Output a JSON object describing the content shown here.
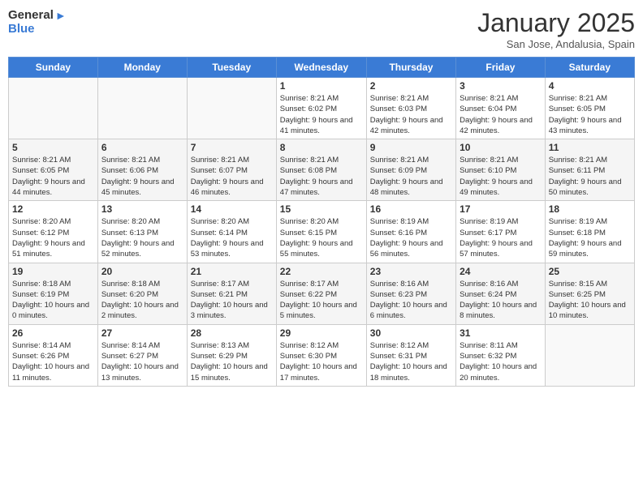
{
  "logo": {
    "general": "General",
    "blue": "Blue"
  },
  "header": {
    "month": "January 2025",
    "location": "San Jose, Andalusia, Spain"
  },
  "weekdays": [
    "Sunday",
    "Monday",
    "Tuesday",
    "Wednesday",
    "Thursday",
    "Friday",
    "Saturday"
  ],
  "weeks": [
    [
      {
        "day": "",
        "sunrise": "",
        "sunset": "",
        "daylight": ""
      },
      {
        "day": "",
        "sunrise": "",
        "sunset": "",
        "daylight": ""
      },
      {
        "day": "",
        "sunrise": "",
        "sunset": "",
        "daylight": ""
      },
      {
        "day": "1",
        "sunrise": "Sunrise: 8:21 AM",
        "sunset": "Sunset: 6:02 PM",
        "daylight": "Daylight: 9 hours and 41 minutes."
      },
      {
        "day": "2",
        "sunrise": "Sunrise: 8:21 AM",
        "sunset": "Sunset: 6:03 PM",
        "daylight": "Daylight: 9 hours and 42 minutes."
      },
      {
        "day": "3",
        "sunrise": "Sunrise: 8:21 AM",
        "sunset": "Sunset: 6:04 PM",
        "daylight": "Daylight: 9 hours and 42 minutes."
      },
      {
        "day": "4",
        "sunrise": "Sunrise: 8:21 AM",
        "sunset": "Sunset: 6:05 PM",
        "daylight": "Daylight: 9 hours and 43 minutes."
      }
    ],
    [
      {
        "day": "5",
        "sunrise": "Sunrise: 8:21 AM",
        "sunset": "Sunset: 6:05 PM",
        "daylight": "Daylight: 9 hours and 44 minutes."
      },
      {
        "day": "6",
        "sunrise": "Sunrise: 8:21 AM",
        "sunset": "Sunset: 6:06 PM",
        "daylight": "Daylight: 9 hours and 45 minutes."
      },
      {
        "day": "7",
        "sunrise": "Sunrise: 8:21 AM",
        "sunset": "Sunset: 6:07 PM",
        "daylight": "Daylight: 9 hours and 46 minutes."
      },
      {
        "day": "8",
        "sunrise": "Sunrise: 8:21 AM",
        "sunset": "Sunset: 6:08 PM",
        "daylight": "Daylight: 9 hours and 47 minutes."
      },
      {
        "day": "9",
        "sunrise": "Sunrise: 8:21 AM",
        "sunset": "Sunset: 6:09 PM",
        "daylight": "Daylight: 9 hours and 48 minutes."
      },
      {
        "day": "10",
        "sunrise": "Sunrise: 8:21 AM",
        "sunset": "Sunset: 6:10 PM",
        "daylight": "Daylight: 9 hours and 49 minutes."
      },
      {
        "day": "11",
        "sunrise": "Sunrise: 8:21 AM",
        "sunset": "Sunset: 6:11 PM",
        "daylight": "Daylight: 9 hours and 50 minutes."
      }
    ],
    [
      {
        "day": "12",
        "sunrise": "Sunrise: 8:20 AM",
        "sunset": "Sunset: 6:12 PM",
        "daylight": "Daylight: 9 hours and 51 minutes."
      },
      {
        "day": "13",
        "sunrise": "Sunrise: 8:20 AM",
        "sunset": "Sunset: 6:13 PM",
        "daylight": "Daylight: 9 hours and 52 minutes."
      },
      {
        "day": "14",
        "sunrise": "Sunrise: 8:20 AM",
        "sunset": "Sunset: 6:14 PM",
        "daylight": "Daylight: 9 hours and 53 minutes."
      },
      {
        "day": "15",
        "sunrise": "Sunrise: 8:20 AM",
        "sunset": "Sunset: 6:15 PM",
        "daylight": "Daylight: 9 hours and 55 minutes."
      },
      {
        "day": "16",
        "sunrise": "Sunrise: 8:19 AM",
        "sunset": "Sunset: 6:16 PM",
        "daylight": "Daylight: 9 hours and 56 minutes."
      },
      {
        "day": "17",
        "sunrise": "Sunrise: 8:19 AM",
        "sunset": "Sunset: 6:17 PM",
        "daylight": "Daylight: 9 hours and 57 minutes."
      },
      {
        "day": "18",
        "sunrise": "Sunrise: 8:19 AM",
        "sunset": "Sunset: 6:18 PM",
        "daylight": "Daylight: 9 hours and 59 minutes."
      }
    ],
    [
      {
        "day": "19",
        "sunrise": "Sunrise: 8:18 AM",
        "sunset": "Sunset: 6:19 PM",
        "daylight": "Daylight: 10 hours and 0 minutes."
      },
      {
        "day": "20",
        "sunrise": "Sunrise: 8:18 AM",
        "sunset": "Sunset: 6:20 PM",
        "daylight": "Daylight: 10 hours and 2 minutes."
      },
      {
        "day": "21",
        "sunrise": "Sunrise: 8:17 AM",
        "sunset": "Sunset: 6:21 PM",
        "daylight": "Daylight: 10 hours and 3 minutes."
      },
      {
        "day": "22",
        "sunrise": "Sunrise: 8:17 AM",
        "sunset": "Sunset: 6:22 PM",
        "daylight": "Daylight: 10 hours and 5 minutes."
      },
      {
        "day": "23",
        "sunrise": "Sunrise: 8:16 AM",
        "sunset": "Sunset: 6:23 PM",
        "daylight": "Daylight: 10 hours and 6 minutes."
      },
      {
        "day": "24",
        "sunrise": "Sunrise: 8:16 AM",
        "sunset": "Sunset: 6:24 PM",
        "daylight": "Daylight: 10 hours and 8 minutes."
      },
      {
        "day": "25",
        "sunrise": "Sunrise: 8:15 AM",
        "sunset": "Sunset: 6:25 PM",
        "daylight": "Daylight: 10 hours and 10 minutes."
      }
    ],
    [
      {
        "day": "26",
        "sunrise": "Sunrise: 8:14 AM",
        "sunset": "Sunset: 6:26 PM",
        "daylight": "Daylight: 10 hours and 11 minutes."
      },
      {
        "day": "27",
        "sunrise": "Sunrise: 8:14 AM",
        "sunset": "Sunset: 6:27 PM",
        "daylight": "Daylight: 10 hours and 13 minutes."
      },
      {
        "day": "28",
        "sunrise": "Sunrise: 8:13 AM",
        "sunset": "Sunset: 6:29 PM",
        "daylight": "Daylight: 10 hours and 15 minutes."
      },
      {
        "day": "29",
        "sunrise": "Sunrise: 8:12 AM",
        "sunset": "Sunset: 6:30 PM",
        "daylight": "Daylight: 10 hours and 17 minutes."
      },
      {
        "day": "30",
        "sunrise": "Sunrise: 8:12 AM",
        "sunset": "Sunset: 6:31 PM",
        "daylight": "Daylight: 10 hours and 18 minutes."
      },
      {
        "day": "31",
        "sunrise": "Sunrise: 8:11 AM",
        "sunset": "Sunset: 6:32 PM",
        "daylight": "Daylight: 10 hours and 20 minutes."
      },
      {
        "day": "",
        "sunrise": "",
        "sunset": "",
        "daylight": ""
      }
    ]
  ]
}
